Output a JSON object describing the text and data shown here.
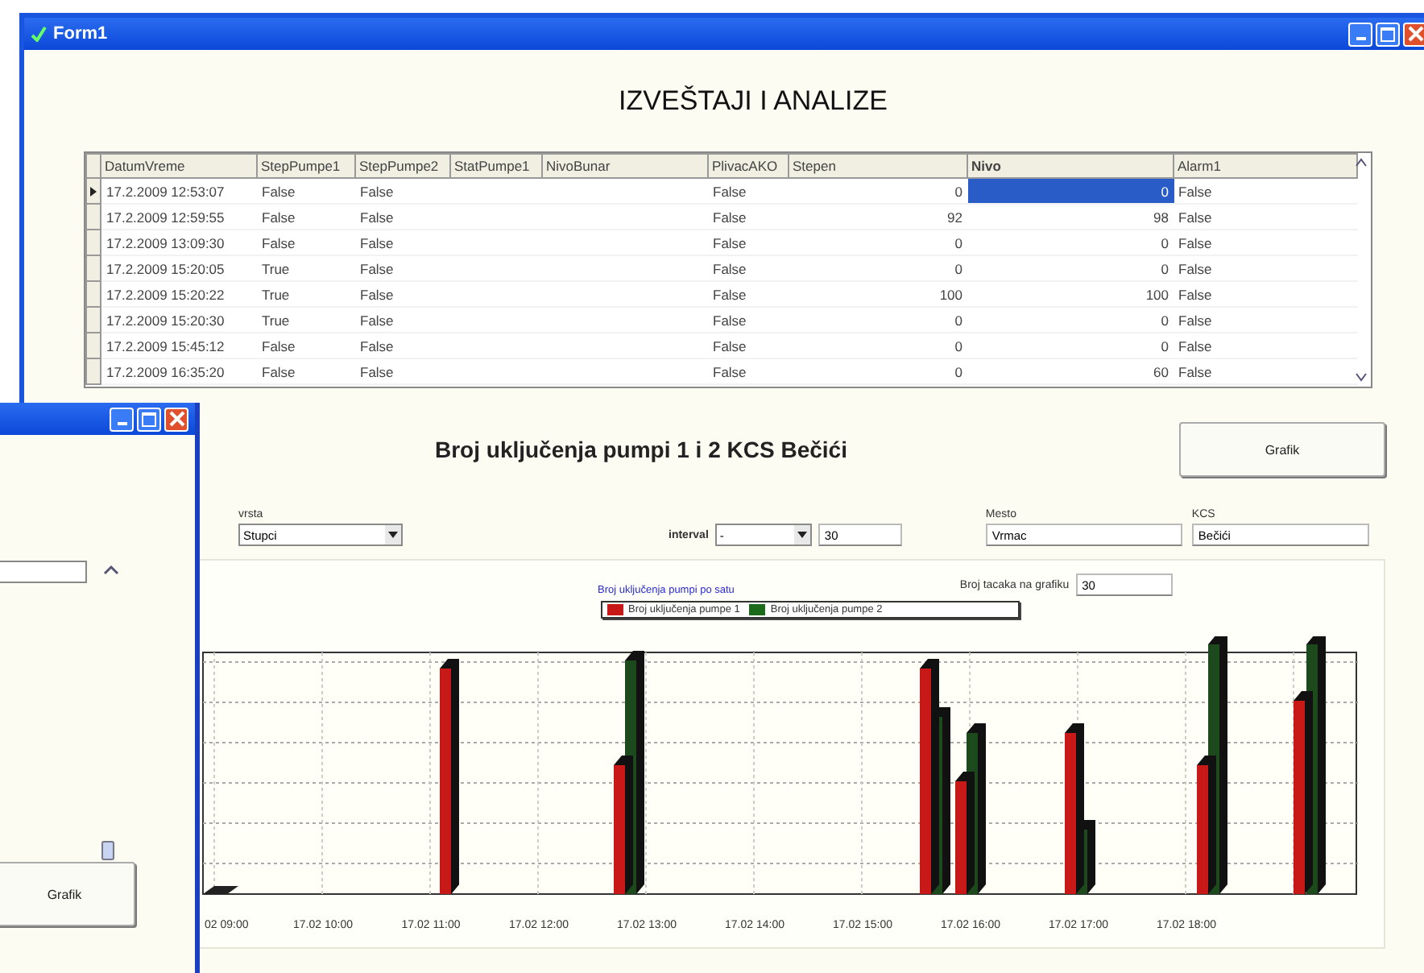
{
  "window": {
    "title": "Form1"
  },
  "heading": "IZVEŠTAJI I ANALIZE",
  "table": {
    "columns": [
      {
        "label": "DatumVreme",
        "kind": "text",
        "focused": false
      },
      {
        "label": "StepPumpe1",
        "kind": "text",
        "focused": false
      },
      {
        "label": "StepPumpe2",
        "kind": "text",
        "focused": false
      },
      {
        "label": "StatPumpe1",
        "kind": "text",
        "focused": false
      },
      {
        "label": "NivoBunar",
        "kind": "text",
        "focused": false
      },
      {
        "label": "PlivacAKO",
        "kind": "text",
        "focused": false
      },
      {
        "label": "Stepen",
        "kind": "number",
        "focused": false
      },
      {
        "label": "Nivo",
        "kind": "number",
        "focused": true
      },
      {
        "label": "Alarm1",
        "kind": "text",
        "focused": false
      }
    ],
    "rows": [
      {
        "selected": true,
        "cells": [
          "17.2.2009 12:53:07",
          "False",
          "False",
          null,
          null,
          "False",
          "0",
          "0",
          "False"
        ]
      },
      {
        "selected": false,
        "cells": [
          "17.2.2009 12:59:55",
          "False",
          "False",
          null,
          null,
          "False",
          "92",
          "98",
          "False"
        ]
      },
      {
        "selected": false,
        "cells": [
          "17.2.2009 13:09:30",
          "False",
          "False",
          null,
          null,
          "False",
          "0",
          "0",
          "False"
        ]
      },
      {
        "selected": false,
        "cells": [
          "17.2.2009 15:20:05",
          "True",
          "False",
          null,
          null,
          "False",
          "0",
          "0",
          "False"
        ]
      },
      {
        "selected": false,
        "cells": [
          "17.2.2009 15:20:22",
          "True",
          "False",
          null,
          null,
          "False",
          "100",
          "100",
          "False"
        ]
      },
      {
        "selected": false,
        "cells": [
          "17.2.2009 15:20:30",
          "True",
          "False",
          null,
          null,
          "False",
          "0",
          "0",
          "False"
        ]
      },
      {
        "selected": false,
        "cells": [
          "17.2.2009 15:45:12",
          "False",
          "False",
          null,
          null,
          "False",
          "0",
          "0",
          "False"
        ]
      },
      {
        "selected": false,
        "cells": [
          "17.2.2009 16:35:20",
          "False",
          "False",
          null,
          null,
          "False",
          "0",
          "60",
          "False"
        ]
      }
    ]
  },
  "report": {
    "title": "Broj uključenja pumpi 1 i 2 KCS Bečići",
    "graph_button": "Grafik",
    "type": {
      "label": "vrsta",
      "value": "Stupci"
    },
    "interval": {
      "label": "interval",
      "value": "-",
      "count": "30"
    },
    "place": {
      "label": "Mesto",
      "value": "Vrmac"
    },
    "station": {
      "label": "KCS",
      "value": "Bečići"
    },
    "points": {
      "label": "Broj tacaka na grafiku",
      "value": "30"
    },
    "chart": {
      "title": "Broj uključenja pumpi po satu",
      "legend": [
        {
          "label": "Broj uključenja pumpe 1",
          "color": "#c81818"
        },
        {
          "label": "Broj uključenja pumpe 2",
          "color": "#1c6a1c"
        }
      ],
      "x_labels": [
        "02 09:00",
        "17.02 10:00",
        "17.02 11:00",
        "17.02 12:00",
        "17.02 13:00",
        "17.02 14:00",
        "17.02 15:00",
        "17.02 16:00",
        "17.02 17:00",
        "17.02 18:00"
      ]
    }
  },
  "second_window": {
    "graph_button": "Grafik"
  }
}
